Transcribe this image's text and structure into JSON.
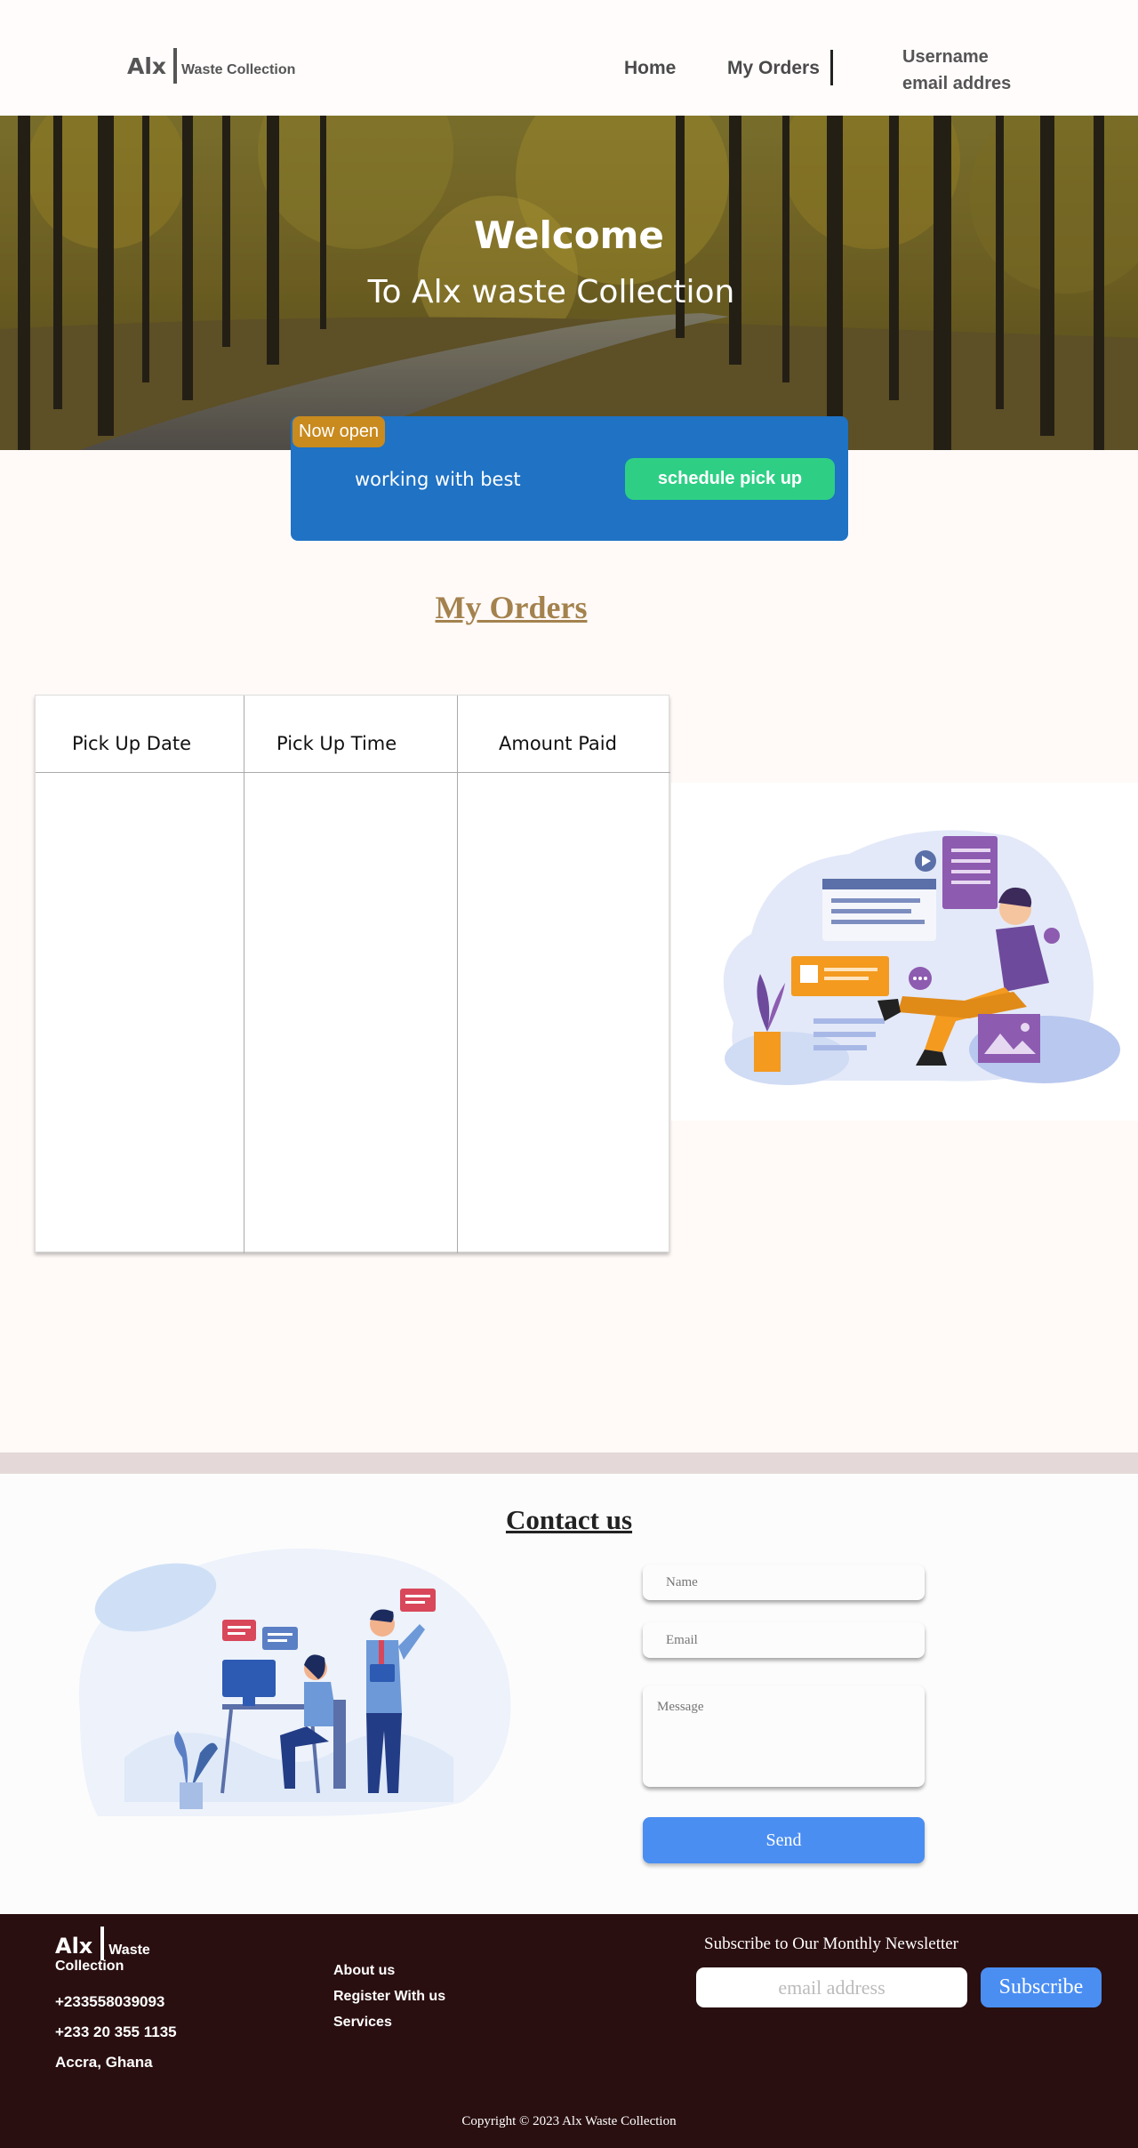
{
  "header": {
    "logo_main": "Alx",
    "logo_sub": "Waste Collection",
    "nav": {
      "home": "Home",
      "orders": "My Orders"
    },
    "user": {
      "name": "Username",
      "email": "email addres"
    }
  },
  "hero": {
    "title": "Welcome",
    "subtitle": "To Alx waste  Collection"
  },
  "banner": {
    "badge": "Now open",
    "text": "working with best",
    "button": "schedule pick up"
  },
  "orders": {
    "title": "My Orders",
    "columns": [
      "Pick Up Date",
      "Pick Up Time",
      "Amount Paid"
    ],
    "rows": []
  },
  "contact": {
    "title": "Contact us",
    "name_placeholder": "Name",
    "email_placeholder": "Email",
    "message_placeholder": "Message",
    "send": "Send"
  },
  "footer": {
    "logo_main": "Alx",
    "logo_sub_1": "Waste",
    "logo_sub_2": "Collection",
    "phone_1": "+233558039093",
    "phone_2": "+233 20 355 1135",
    "address": "Accra, Ghana",
    "links": [
      "About us",
      "Register With us",
      "Services"
    ],
    "newsletter_label": "Subscribe to Our Monthly Newsletter",
    "newsletter_placeholder": "email address",
    "subscribe": "Subscribe",
    "copyright": "Copyright © 2023 Alx Waste Collection"
  },
  "colors": {
    "banner": "#1f72c4",
    "badge": "#c98a1e",
    "pickup_button": "#2ecf85",
    "orders_title": "#a4824e",
    "send_button": "#4a8ef2",
    "footer_bg": "#2a0f10"
  }
}
